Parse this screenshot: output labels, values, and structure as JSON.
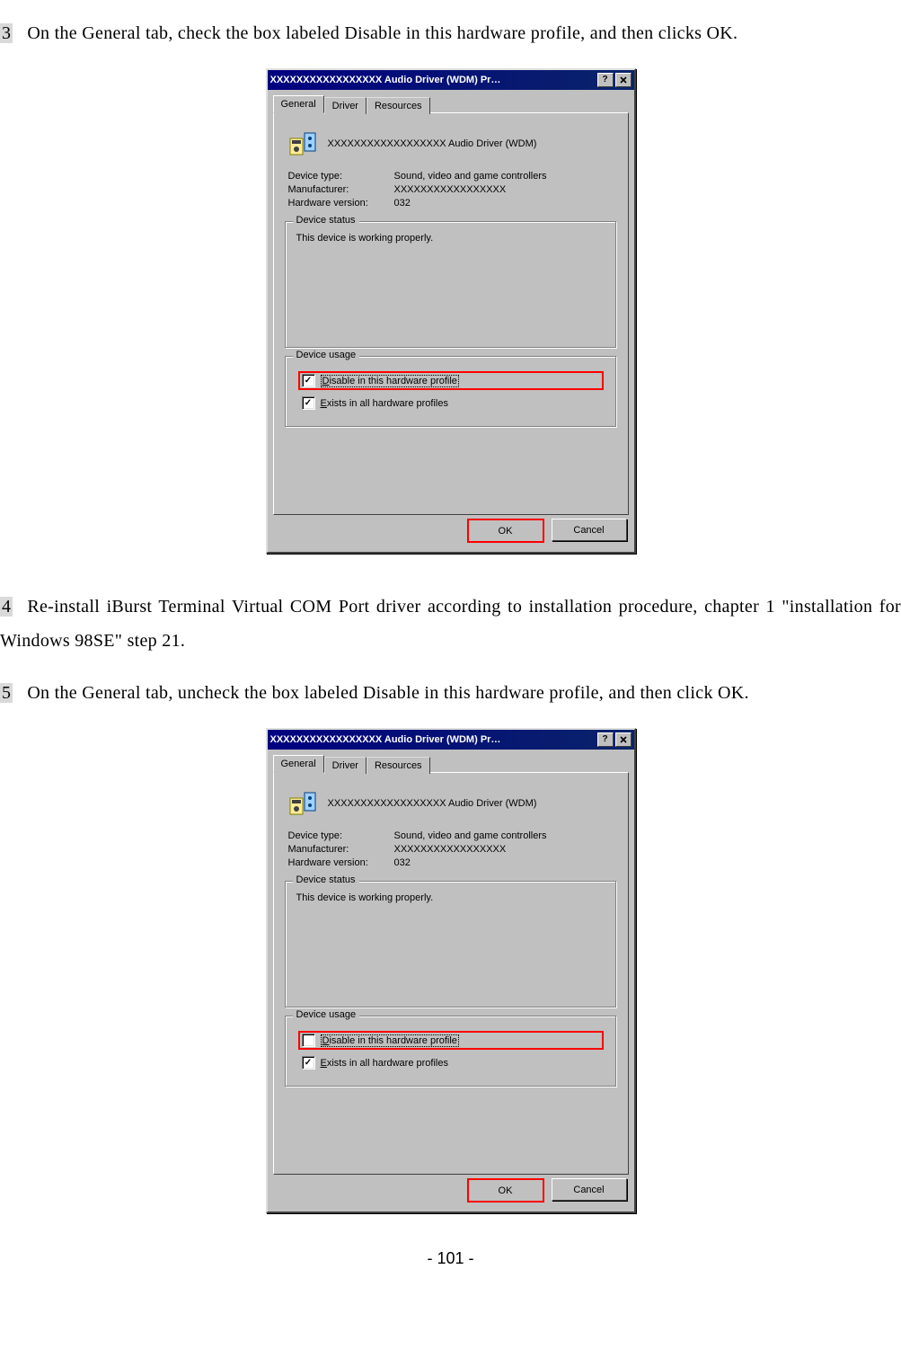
{
  "steps": {
    "s3": {
      "num": "3",
      "text": "On the General tab, check the box labeled Disable in this hardware profile, and then clicks OK."
    },
    "s4": {
      "num": "4",
      "text": "Re-install iBurst Terminal Virtual COM Port driver according to installation procedure, chapter 1 \"installation for Windows 98SE\" step 21."
    },
    "s5": {
      "num": "5",
      "text": "On the General tab, uncheck the box labeled Disable in this hardware profile, and then click OK."
    }
  },
  "dialog": {
    "title": "XXXXXXXXXXXXXXXXX   Audio Driver (WDM) Pr…",
    "tabs": {
      "general": "General",
      "driver": "Driver",
      "resources": "Resources"
    },
    "device_name": "XXXXXXXXXXXXXXXXXX   Audio Driver (WDM)",
    "info": {
      "type_label": "Device type:",
      "type_value": "Sound, video and game controllers",
      "mfr_label": "Manufacturer:",
      "mfr_value": "XXXXXXXXXXXXXXXXX",
      "hwver_label": "Hardware version:",
      "hwver_value": "032"
    },
    "status": {
      "legend": "Device status",
      "text": "This device is working properly."
    },
    "usage": {
      "legend": "Device usage",
      "disable_prefix": "D",
      "disable_rest": "isable in this hardware profile",
      "exists_prefix": "E",
      "exists_rest": "xists in all hardware profiles"
    },
    "buttons": {
      "ok": "OK",
      "cancel": "Cancel"
    },
    "checkmark": "✓"
  },
  "footer": "- 101 -"
}
